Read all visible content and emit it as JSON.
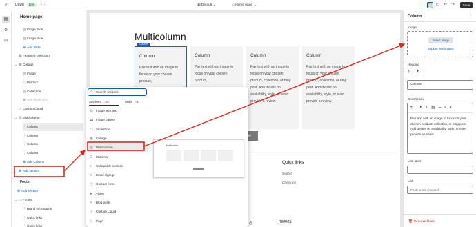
{
  "topbar": {
    "theme_name": "Dawn",
    "live_badge": "Live",
    "template_select": "Default",
    "page_select": "Home page",
    "save_label": "Save",
    "more_label": "···"
  },
  "left_panel": {
    "title": "Home page",
    "items": [
      {
        "label": "Image slide",
        "icon": "image-icon",
        "indent": 2
      },
      {
        "label": "Image slide",
        "icon": "image-icon",
        "indent": 2
      },
      {
        "label": "Add Slide",
        "icon": "plus-circle-icon",
        "indent": 2,
        "link": true
      },
      {
        "label": "Featured collection",
        "icon": "grid-icon",
        "indent": 1
      },
      {
        "label": "Collage",
        "icon": "collage-icon",
        "indent": 0,
        "caret": true
      },
      {
        "label": "Image",
        "icon": "image-icon",
        "indent": 2
      },
      {
        "label": "Product",
        "icon": "tag-icon",
        "indent": 2
      },
      {
        "label": "Collection",
        "icon": "collection-icon",
        "indent": 2
      },
      {
        "label": "Add block (3/3)",
        "icon": "plus-circle-icon",
        "indent": 2,
        "muted": true
      },
      {
        "label": "Custom Liquid",
        "icon": "code-icon",
        "indent": 1
      },
      {
        "label": "Multicolumn",
        "icon": "columns-icon",
        "indent": 0,
        "caret": true
      },
      {
        "label": "Column",
        "icon": "drag-icon",
        "indent": 2,
        "selected": true
      },
      {
        "label": "Column",
        "icon": "drag-icon",
        "indent": 2
      },
      {
        "label": "Column",
        "icon": "drag-icon",
        "indent": 2
      },
      {
        "label": "Column",
        "icon": "drag-icon",
        "indent": 2
      },
      {
        "label": "Add Column",
        "icon": "plus-circle-icon",
        "indent": 2,
        "link": true
      },
      {
        "label": "Add section",
        "icon": "plus-circle-icon",
        "indent": 1,
        "link": true
      }
    ],
    "footer_group": "Footer",
    "footer_add_section": "Add section",
    "footer_items": [
      {
        "label": "Footer",
        "icon": "footer-icon",
        "indent": 0,
        "caret": true
      },
      {
        "label": "Brand information",
        "icon": "drag-icon",
        "indent": 2
      },
      {
        "label": "Quick links",
        "icon": "drag-icon",
        "indent": 2
      },
      {
        "label": "Quick links",
        "icon": "drag-icon",
        "indent": 2
      }
    ]
  },
  "preview": {
    "heading": "Multicolumn",
    "column_tag": "Column",
    "columns": [
      {
        "title": "Column",
        "body": "Pair text with an image to focus on your chosen product,"
      },
      {
        "title": "Column",
        "body": "Pair text with an image to focus on your chosen product,"
      },
      {
        "title": "Column",
        "body": "Pair text with an image to focus on your chosen product, collection, or blog post. Add details on availability, style, or even provide a review."
      },
      {
        "title": "Column",
        "body": "Pair text with an image to focus on your chosen product, collection, or blog post. Add details on availability, style, or even provide a review."
      }
    ],
    "button_label": "label",
    "quick_links_title": "Quick links",
    "quick_links": [
      "Search",
      "Check ok"
    ],
    "terms": "TERMS"
  },
  "popover": {
    "search_placeholder": "Search sections",
    "tab_sections": "Sections",
    "tab_sections_count": "17",
    "tab_apps": "Apps",
    "tab_apps_count": "5",
    "items": [
      {
        "label": "Image with text",
        "icon": "image-text-icon"
      },
      {
        "label": "Image banner",
        "icon": "banner-icon"
      },
      {
        "label": "Slideshow",
        "icon": "slideshow-icon"
      },
      {
        "label": "Collage",
        "icon": "collage-icon"
      },
      {
        "label": "Multicolumn",
        "icon": "columns-icon",
        "hover": true
      },
      {
        "label": "Multirow",
        "icon": "rows-icon"
      },
      {
        "label": "Collapsible content",
        "icon": "collapse-icon"
      },
      {
        "label": "Email signup",
        "icon": "email-icon"
      },
      {
        "label": "Contact form",
        "icon": "form-icon"
      },
      {
        "label": "Video",
        "icon": "video-icon"
      },
      {
        "label": "Blog posts",
        "icon": "blog-icon"
      },
      {
        "label": "Custom Liquid",
        "icon": "code-icon"
      },
      {
        "label": "Page",
        "icon": "page-icon"
      }
    ],
    "thumb_title": "Multicolumn"
  },
  "right_panel": {
    "title": "Column",
    "image_label": "Image",
    "select_image": "Select image",
    "explore_free": "Explore free images",
    "heading_label": "Heading",
    "heading_value": "Column",
    "description_label": "Description",
    "description_value": "Pair text with an image to focus on your chosen product, collection, or blog post. Add details on availability, style, or even provide a review.",
    "link_label_label": "Link label",
    "link_label": "Link",
    "link_placeholder": "Paste a link or search",
    "remove_block": "Remove block"
  },
  "colors": {
    "accent_blue": "#005bd3",
    "annotation_red": "#e0241b",
    "save_bg": "#303030"
  }
}
